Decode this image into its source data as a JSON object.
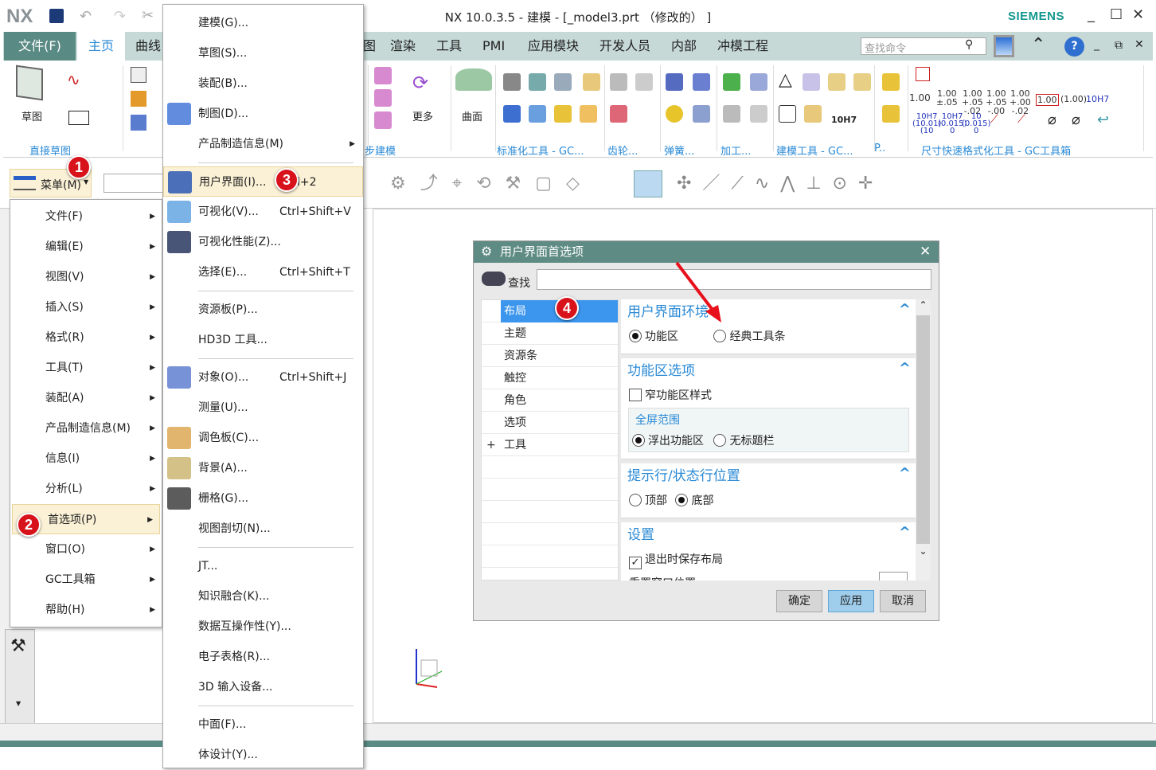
{
  "titlebar": {
    "logo": "NX",
    "title": "NX 10.0.3.5 - 建模 - [_model3.prt （修改的） ]",
    "brand": "SIEMENS",
    "min": "_",
    "max": "☐",
    "close": "✕"
  },
  "tabs": {
    "file": "文件(F)",
    "home": "主页",
    "curve": "曲线",
    "partial": "图",
    "items": [
      "渲染",
      "工具",
      "PMI",
      "应用模块",
      "开发人员",
      "内部",
      "冲模工程"
    ],
    "search_placeholder": "查找命令"
  },
  "ribbon": {
    "sketch": "草图",
    "more": "更多",
    "surface": "曲面",
    "groups": [
      "直接草图",
      "步建模",
      "标准化工具 - GC...",
      "齿轮...",
      "弹簧...",
      "加工...",
      "建模工具 - GC...",
      "P..",
      "尺寸快速格式化工具 - GC工具箱"
    ],
    "dims": [
      "1.00",
      "1.00\n±.05",
      "1.00\n+.05\n-.02",
      "1.00\n+.05\n-.00",
      "1.00\n+.00\n-.02",
      "1.00",
      "(1.00)",
      "10H7"
    ],
    "dims2": [
      "10H7\n(10.01)\n(10",
      "10H7\n(0.015)\n0",
      "10\n(0.015)\n0"
    ],
    "tol": "10H7"
  },
  "toolbar": {
    "menu_label": "菜单(M)"
  },
  "main_menu": {
    "items": [
      {
        "label": "文件(F)"
      },
      {
        "label": "编辑(E)"
      },
      {
        "label": "视图(V)"
      },
      {
        "label": "插入(S)"
      },
      {
        "label": "格式(R)"
      },
      {
        "label": "工具(T)"
      },
      {
        "label": "装配(A)"
      },
      {
        "label": "产品制造信息(M)"
      },
      {
        "label": "信息(I)"
      },
      {
        "label": "分析(L)"
      },
      {
        "label": "首选项(P)",
        "highlighted": true
      },
      {
        "label": "窗口(O)"
      },
      {
        "label": "GC工具箱"
      },
      {
        "label": "帮助(H)"
      }
    ]
  },
  "submenu": {
    "items": [
      {
        "label": "建模(G)..."
      },
      {
        "label": "草图(S)..."
      },
      {
        "label": "装配(B)..."
      },
      {
        "label": "制图(D)...",
        "icon": "drafting-icon"
      },
      {
        "label": "产品制造信息(M)",
        "submenu": true
      },
      {
        "sep": true
      },
      {
        "label": "用户界面(I)...",
        "shortcut": "Ctrl+2",
        "icon": "user-interface-icon",
        "highlighted": true
      },
      {
        "label": "可视化(V)...",
        "shortcut": "Ctrl+Shift+V",
        "icon": "visualization-icon"
      },
      {
        "label": "可视化性能(Z)...",
        "icon": "visualization-performance-icon"
      },
      {
        "label": "选择(E)...",
        "shortcut": "Ctrl+Shift+T"
      },
      {
        "sep": true
      },
      {
        "label": "资源板(P)..."
      },
      {
        "label": "HD3D 工具..."
      },
      {
        "sep": true
      },
      {
        "label": "对象(O)...",
        "shortcut": "Ctrl+Shift+J",
        "icon": "object-icon"
      },
      {
        "label": "测量(U)..."
      },
      {
        "label": "调色板(C)...",
        "icon": "palette-icon"
      },
      {
        "label": "背景(A)...",
        "icon": "background-icon"
      },
      {
        "label": "栅格(G)...",
        "icon": "grid-icon"
      },
      {
        "label": "视图剖切(N)..."
      },
      {
        "sep": true
      },
      {
        "label": "JT..."
      },
      {
        "label": "知识融合(K)..."
      },
      {
        "label": "数据互操作性(Y)..."
      },
      {
        "label": "电子表格(R)..."
      },
      {
        "label": "3D 输入设备..."
      },
      {
        "sep": true
      },
      {
        "label": "中面(F)..."
      },
      {
        "label": "体设计(Y)..."
      }
    ]
  },
  "badges": [
    "1",
    "2",
    "3",
    "4"
  ],
  "dialog": {
    "title": "用户界面首选项",
    "search_label": "查找",
    "tree": [
      "布局",
      "主题",
      "资源条",
      "触控",
      "角色",
      "选项",
      "工具"
    ],
    "sections": {
      "env": {
        "title": "用户界面环境",
        "opt1": "功能区",
        "opt2": "经典工具条"
      },
      "ribbon": {
        "title": "功能区选项",
        "narrow": "窄功能区样式",
        "fullscreen": "全屏范围",
        "opt1": "浮出功能区",
        "opt2": "无标题栏"
      },
      "cue": {
        "title": "提示行/状态行位置",
        "top": "顶部",
        "bottom": "底部"
      },
      "settings": {
        "title": "设置",
        "save": "退出时保存布局",
        "reset": "重置窗口位置"
      }
    },
    "ok": "确定",
    "apply": "应用",
    "cancel": "取消"
  },
  "colors": {
    "accent": "#2a8ad6",
    "teal": "#5a8a84",
    "highlight": "#fbf1d6",
    "badge": "#d8121b"
  }
}
